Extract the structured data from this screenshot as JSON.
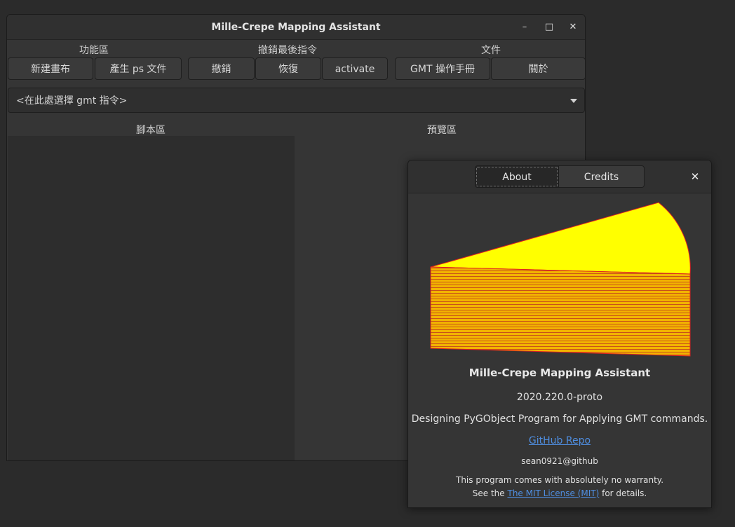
{
  "window": {
    "title": "Mille-Crepe Mapping Assistant",
    "minimize": "–",
    "maximize": "□",
    "close": "✕"
  },
  "toolbar": {
    "sections": [
      "功能區",
      "撤銷最後指令",
      "文件"
    ],
    "buttons": [
      "新建畫布",
      "產生 ps 文件",
      "撤銷",
      "恢復",
      "activate",
      "GMT 操作手冊",
      "關於"
    ]
  },
  "command_combo": {
    "placeholder": "<在此處選擇 gmt 指令>"
  },
  "panes": {
    "script_label": "腳本區",
    "preview_label": "預覽區"
  },
  "about": {
    "tabs": [
      "About",
      "Credits"
    ],
    "close": "✕",
    "program_name": "Mille-Crepe Mapping Assistant",
    "version": "2020.220.0-proto",
    "comments": "Designing PyGObject Program for Applying GMT commands.",
    "website_label": "GitHub Repo",
    "copyright": "sean0921@github",
    "warranty": "This program comes with absolutely no warranty.",
    "license_prefix": "See the ",
    "license_link": "The MIT License (MIT)",
    "license_suffix": " for details.",
    "logo_icon": "cake-slice-logo",
    "colors": {
      "cake_top": "#ffff00",
      "cake_side": "#f5b800",
      "cake_edge": "#e01818",
      "link": "#4f8ee0"
    }
  }
}
